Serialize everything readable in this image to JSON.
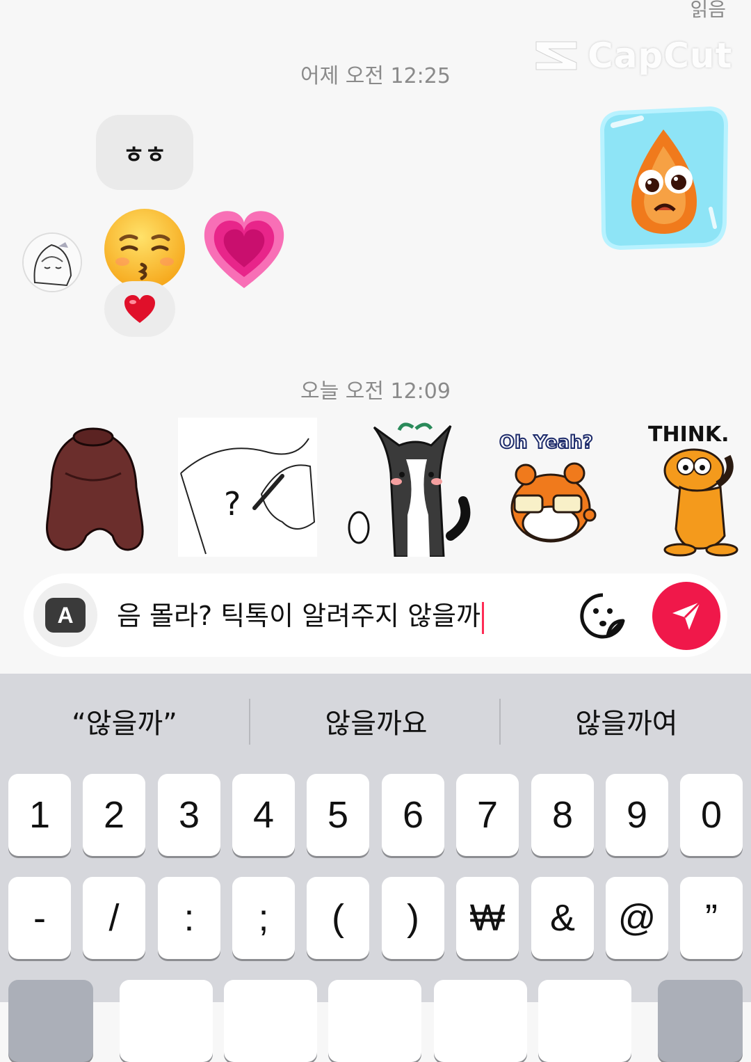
{
  "header": {
    "read_status": "읽음"
  },
  "watermark": {
    "text": "CapCut"
  },
  "messages": {
    "yesterday_stamp": "어제 오전 12:25",
    "bubble_text": "ㅎㅎ",
    "kiss_emoji": "😚",
    "heart_emoji": "💗",
    "reaction_emoji": "❤️",
    "today_stamp": "오늘 오전 12:09"
  },
  "stickers": [
    {
      "name": "bear-sticker"
    },
    {
      "name": "hand-question-sticker"
    },
    {
      "name": "cat-sticker"
    },
    {
      "name": "oh-yeah-hamster-sticker",
      "caption": "Oh Yeah?"
    },
    {
      "name": "garfield-think-sticker",
      "caption": "THINK."
    }
  ],
  "composer": {
    "keyboard_mode_label": "A",
    "input_value": "음 몰라? 틱톡이 알려주지 않을까"
  },
  "keyboard": {
    "suggestions": [
      "“않을까”",
      "않을까요",
      "않을까여"
    ],
    "row1": [
      "1",
      "2",
      "3",
      "4",
      "5",
      "6",
      "7",
      "8",
      "9",
      "0"
    ],
    "row2": [
      "-",
      "/",
      ":",
      ";",
      "(",
      ")",
      "₩",
      "&",
      "@",
      "”"
    ]
  },
  "colors": {
    "accent": "#f0184a",
    "keyboard_bg": "#d6d7dc",
    "chat_bg": "#f7f7f7"
  }
}
